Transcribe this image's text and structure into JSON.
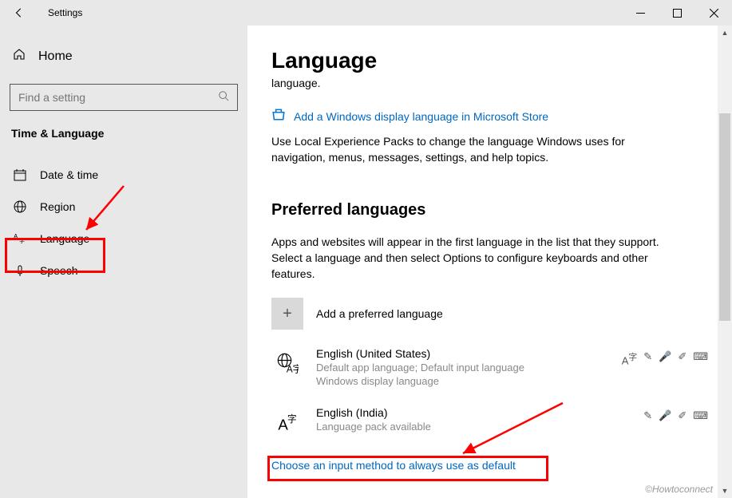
{
  "window": {
    "title": "Settings"
  },
  "sidebar": {
    "home": "Home",
    "search_placeholder": "Find a setting",
    "category": "Time & Language",
    "items": [
      {
        "label": "Date & time"
      },
      {
        "label": "Region"
      },
      {
        "label": "Language"
      },
      {
        "label": "Speech"
      }
    ]
  },
  "main": {
    "title": "Language",
    "crumb": "language.",
    "store_link": "Add a Windows display language in Microsoft Store",
    "store_desc": "Use Local Experience Packs to change the language Windows uses for navigation, menus, messages, settings, and help topics.",
    "preferred_title": "Preferred languages",
    "preferred_desc": "Apps and websites will appear in the first language in the list that they support. Select a language and then select Options to configure keyboards and other features.",
    "add_lang": "Add a preferred language",
    "langs": [
      {
        "name": "English (United States)",
        "line1": "Default app language; Default input language",
        "line2": "Windows display language"
      },
      {
        "name": "English (India)",
        "line1": "Language pack available",
        "line2": ""
      }
    ],
    "choose_link": "Choose an input method to always use as default"
  },
  "watermark": "©Howtoconnect"
}
